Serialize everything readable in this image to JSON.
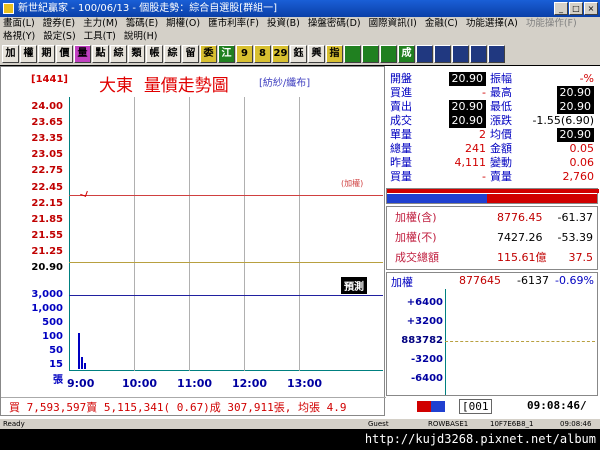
{
  "window": {
    "title": "新世紀贏家 - 100/06/13 - 個股走勢：綜合自選股[群組一]"
  },
  "menu": {
    "row1": [
      "畫面(L)",
      "證券(E)",
      "主力(M)",
      "籌碼(E)",
      "期權(O)",
      "匯市利率(F)",
      "投資(B)",
      "操盤密碼(D)",
      "國際資訊(I)",
      "金融(C)",
      "功能選擇(A)"
    ],
    "row1_disabled": "功能操作(F)",
    "row2": [
      "格視(Y)",
      "設定(S)",
      "工具(T)",
      "說明(H)"
    ]
  },
  "toolbar": [
    "加",
    "權",
    "期",
    "價",
    "量",
    "點",
    "綜",
    "類",
    "帳",
    "綜",
    "留",
    "委",
    "江",
    "9",
    "8",
    "29",
    "鈺",
    "興",
    "指",
    "",
    "",
    "",
    "成",
    "",
    "",
    "",
    "",
    ""
  ],
  "stock": {
    "code": "[1441]",
    "name": "大東",
    "chart_name": "量價走勢圖",
    "industry": "[紡紗/纖布]"
  },
  "price_axis": [
    "24.00",
    "23.65",
    "23.35",
    "23.05",
    "22.75",
    "22.45",
    "22.15",
    "21.85",
    "21.55",
    "21.25",
    "20.90"
  ],
  "volume_axis": [
    "3,000",
    "1,000",
    "500",
    "100",
    "50",
    "15",
    "張"
  ],
  "time_axis": [
    "9:00",
    "10:00",
    "11:00",
    "12:00",
    "13:00"
  ],
  "limit_up_label": "(加權)",
  "dealer_label": "預測",
  "quote": {
    "open_label": "開盤",
    "open": "20.90",
    "amp_label": "振幅",
    "amp": "-%",
    "bid_label": "買進",
    "bid": "-",
    "high_label": "最高",
    "high": "20.90",
    "ask_label": "賣出",
    "ask": "20.90",
    "low_label": "最低",
    "low": "20.90",
    "deal_label": "成交",
    "deal": "20.90",
    "chg_label": "漲跌",
    "chg": "-1.55(6.90)",
    "single_label": "單量",
    "single": "2",
    "avg_label": "均價",
    "avg": "20.90",
    "total_label": "總量",
    "total": "241",
    "amount_label": "金額",
    "amount": "0.05",
    "yday_label": "昨量",
    "yday": "4,111",
    "vol_chg_label": "變動",
    "vol_chg": "0.06",
    "buyvol_label": "買量",
    "buyvol": "-",
    "sellvol_label": "賣量",
    "sellvol": "2,760"
  },
  "index": {
    "incl_label": "加權(含)",
    "incl_val": "8776.45",
    "incl_chg": "-61.37",
    "excl_label": "加權(不)",
    "excl_val": "7427.26",
    "excl_chg": "-53.39",
    "turnover_label": "成交總額",
    "turnover_val": "115.61億",
    "turnover_chg": "37.5"
  },
  "mini": {
    "label": "加權",
    "value": "877645",
    "chg": "-6137",
    "pct": "-0.69%",
    "ticks": [
      "+6400",
      "+3200",
      "883782",
      "-3200",
      "-6400"
    ]
  },
  "bottom_stats": "買 7,593,597賣 5,115,341( 0.67)成 307,911張, 均張 4.9",
  "time_bar": {
    "counter": "001",
    "clock": "09:08:46/"
  },
  "status": {
    "ready": "Ready",
    "guest": "Guest",
    "rowbase": "ROWBASE1",
    "hdr": "10F7E6B8_1",
    "time": "09:08:46"
  },
  "watermark": "http://kujd3268.pixnet.net/album"
}
